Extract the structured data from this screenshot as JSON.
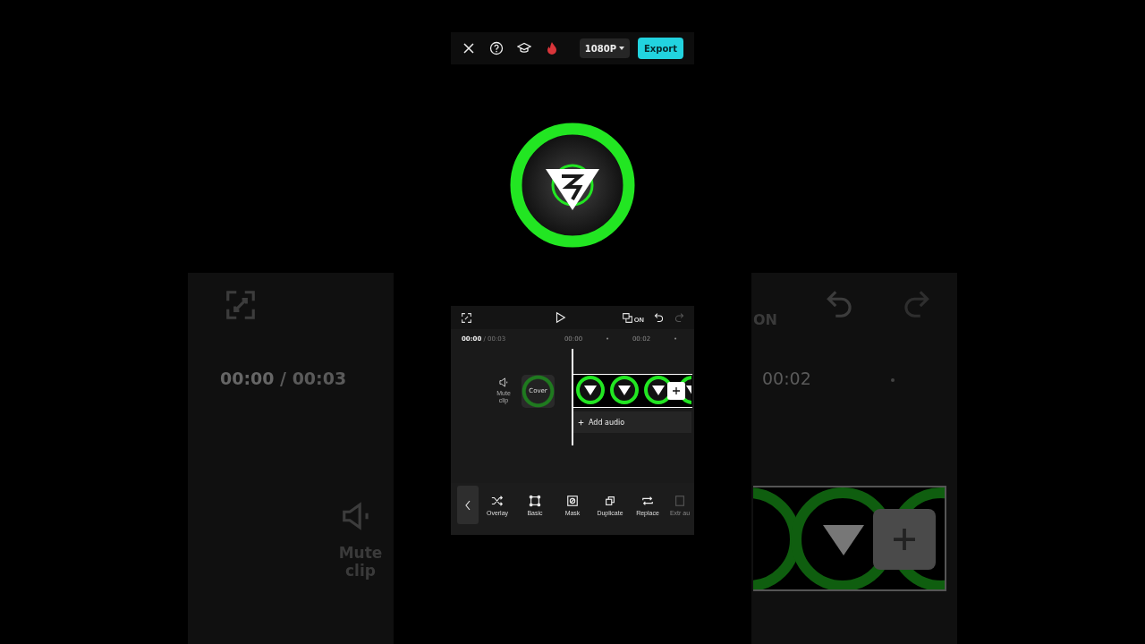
{
  "top_bar": {
    "quality": "1080P",
    "export": "Export"
  },
  "player": {
    "keyframe_badge": "ON",
    "redo_disabled": true
  },
  "timeline": {
    "current": "00:00",
    "duration": "/ 00:03",
    "ruler": [
      "00:00",
      "•",
      "00:02",
      "•"
    ],
    "mute_label": "Mute clip",
    "cover_label": "Cover",
    "add_audio": "Add audio"
  },
  "toolbar": {
    "items": [
      {
        "label": "Overlay",
        "kind": "shuffle",
        "disabled": false
      },
      {
        "label": "Basic",
        "kind": "frame",
        "disabled": false
      },
      {
        "label": "Mask",
        "kind": "mask",
        "disabled": false
      },
      {
        "label": "Duplicate",
        "kind": "duplicate",
        "disabled": false
      },
      {
        "label": "Replace",
        "kind": "replace",
        "disabled": false
      },
      {
        "label": "Extr au",
        "kind": "extract",
        "disabled": true
      }
    ]
  },
  "backdrop": {
    "current": "00:00",
    "duration": "/ 00:03",
    "mute_label": "Mute clip",
    "keyframe_badge": "ON",
    "ruler_time": "00:02"
  }
}
